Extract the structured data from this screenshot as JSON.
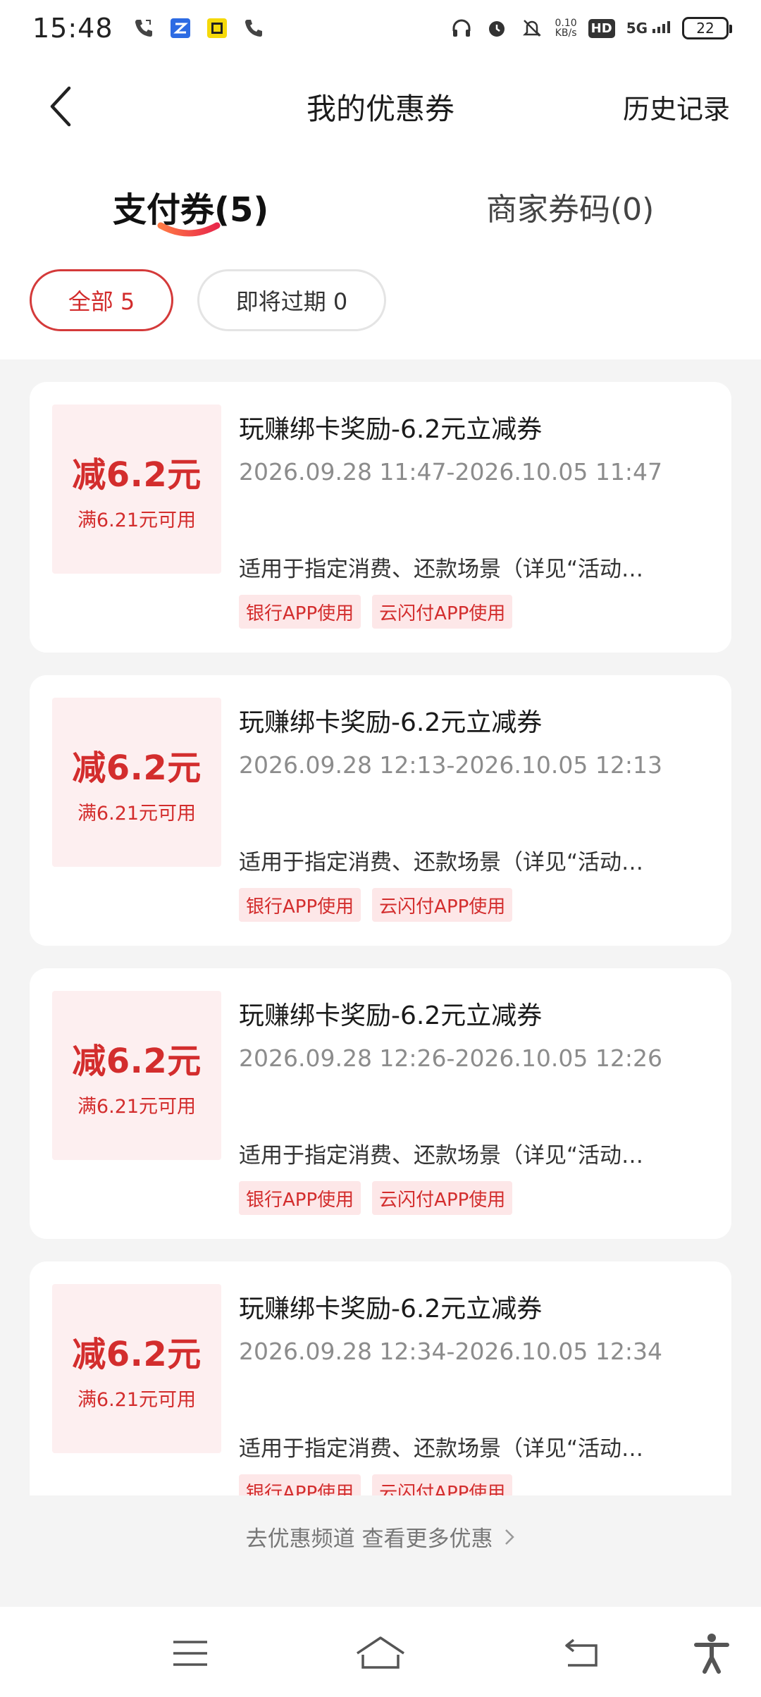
{
  "status_bar": {
    "time": "15:48",
    "net_speed_value": "0.10",
    "net_speed_unit": "KB/s",
    "hd": "HD",
    "signal": "5G",
    "battery": "22"
  },
  "header": {
    "title": "我的优惠券",
    "history": "历史记录"
  },
  "tabs": {
    "pay": "支付券(5)",
    "merchant": "商家券码(0)"
  },
  "filters": {
    "all": "全部 5",
    "expiring": "即将过期 0"
  },
  "coupons": [
    {
      "amount": "减6.2元",
      "condition": "满6.21元可用",
      "title": "玩赚绑卡奖励-6.2元立减券",
      "date": "2026.09.28 11:47-2026.10.05 11:47",
      "desc": "适用于指定消费、还款场景（详见“活动…",
      "tags": [
        "银行APP使用",
        "云闪付APP使用"
      ]
    },
    {
      "amount": "减6.2元",
      "condition": "满6.21元可用",
      "title": "玩赚绑卡奖励-6.2元立减券",
      "date": "2026.09.28 12:13-2026.10.05 12:13",
      "desc": "适用于指定消费、还款场景（详见“活动…",
      "tags": [
        "银行APP使用",
        "云闪付APP使用"
      ]
    },
    {
      "amount": "减6.2元",
      "condition": "满6.21元可用",
      "title": "玩赚绑卡奖励-6.2元立减券",
      "date": "2026.09.28 12:26-2026.10.05 12:26",
      "desc": "适用于指定消费、还款场景（详见“活动…",
      "tags": [
        "银行APP使用",
        "云闪付APP使用"
      ]
    },
    {
      "amount": "减6.2元",
      "condition": "满6.21元可用",
      "title": "玩赚绑卡奖励-6.2元立减券",
      "date": "2026.09.28 12:34-2026.10.05 12:34",
      "desc": "适用于指定消费、还款场景（详见“活动…",
      "tags": [
        "银行APP使用",
        "云闪付APP使用"
      ]
    }
  ],
  "more_link": "去优惠频道 查看更多优惠",
  "colors": {
    "accent": "#d32d2d",
    "badge_bg": "#fdeff0",
    "list_bg": "#f4f4f4"
  }
}
